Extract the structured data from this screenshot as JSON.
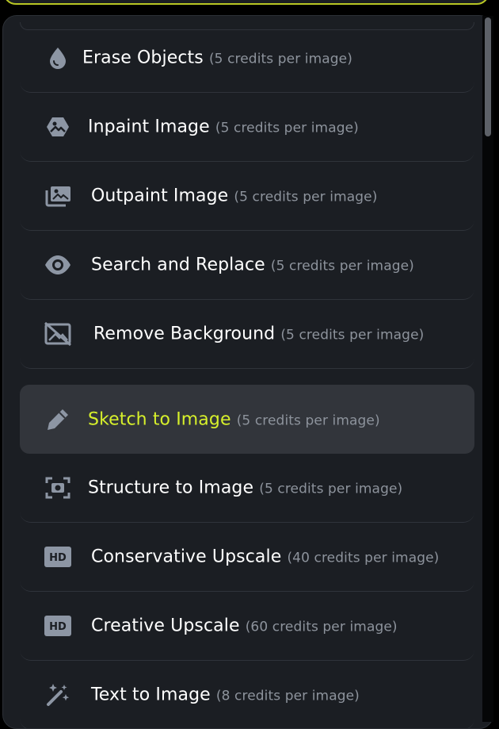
{
  "items": [
    {
      "id": "erase-objects",
      "name": "Erase Objects",
      "credits": "(5 credits per image)",
      "icon": "drop-icon",
      "selected": false
    },
    {
      "id": "inpaint-image",
      "name": "Inpaint Image",
      "credits": "(5 credits per image)",
      "icon": "image-edit-icon",
      "selected": false
    },
    {
      "id": "outpaint-image",
      "name": "Outpaint Image",
      "credits": "(5 credits per image)",
      "icon": "images-icon",
      "selected": false
    },
    {
      "id": "search-and-replace",
      "name": "Search and Replace",
      "credits": "(5 credits per image)",
      "icon": "eye-icon",
      "selected": false
    },
    {
      "id": "remove-background",
      "name": "Remove Background",
      "credits": "(5 credits per image)",
      "icon": "image-off-icon",
      "selected": false
    },
    {
      "id": "sketch-to-image",
      "name": "Sketch to Image",
      "credits": "(5 credits per image)",
      "icon": "pencil-icon",
      "selected": true
    },
    {
      "id": "structure-to-image",
      "name": "Structure to Image",
      "credits": "(5 credits per image)",
      "icon": "camera-frame-icon",
      "selected": false
    },
    {
      "id": "conservative-upscale",
      "name": "Conservative Upscale",
      "credits": "(40 credits per image)",
      "icon": "hd-icon",
      "selected": false
    },
    {
      "id": "creative-upscale",
      "name": "Creative Upscale",
      "credits": "(60 credits per image)",
      "icon": "hd-icon",
      "selected": false
    },
    {
      "id": "text-to-image",
      "name": "Text to Image",
      "credits": "(8 credits per image)",
      "icon": "magic-wand-icon",
      "selected": false
    }
  ],
  "hd_icon_text": "HD",
  "colors": {
    "background": "#1b1e23",
    "selected_background": "#32353b",
    "selected_text": "#d7f02b",
    "accent_border": "#b8c724",
    "text": "#ffffff",
    "muted_text": "#8d939c",
    "icon": "#8d96a4"
  }
}
